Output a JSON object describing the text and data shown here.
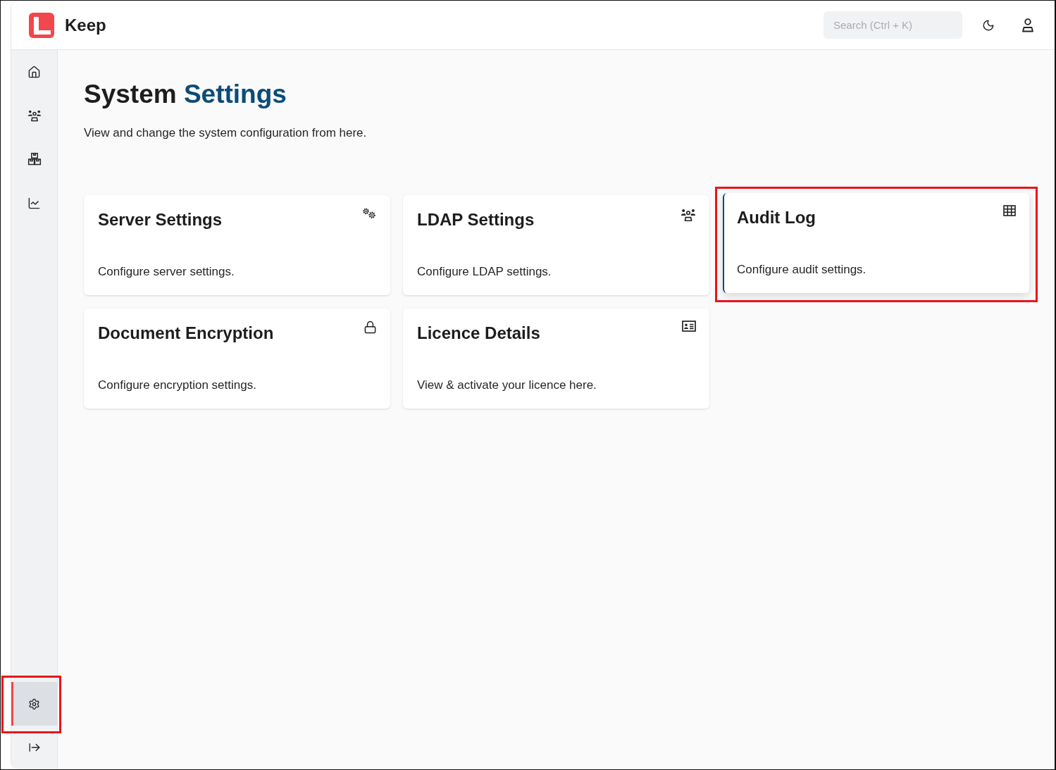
{
  "app": {
    "name": "Keep"
  },
  "header": {
    "search": {
      "placeholder": "Search (Ctrl + K)"
    }
  },
  "sidebar": {
    "top_items": [
      {
        "kind": "home",
        "selected": false,
        "highlighted": false
      },
      {
        "kind": "users",
        "selected": false,
        "highlighted": false
      },
      {
        "kind": "boxes",
        "selected": false,
        "highlighted": false
      },
      {
        "kind": "reports",
        "selected": false,
        "highlighted": false
      }
    ],
    "bottom_items": [
      {
        "kind": "settings",
        "selected": true,
        "highlighted": true
      },
      {
        "kind": "collapse",
        "selected": false,
        "highlighted": false
      }
    ]
  },
  "page": {
    "title": "System",
    "title_accent": "Settings",
    "subtitle": "View and change the system configuration from here."
  },
  "cards": [
    {
      "kind": "server",
      "title": "Server Settings",
      "description": "Configure server settings.",
      "selected": false,
      "highlighted": false
    },
    {
      "kind": "ldap",
      "title": "LDAP Settings",
      "description": "Configure LDAP settings.",
      "selected": false,
      "highlighted": false
    },
    {
      "kind": "audit",
      "title": "Audit Log",
      "description": "Configure audit settings.",
      "selected": true,
      "highlighted": true
    },
    {
      "kind": "encryption",
      "title": "Document Encryption",
      "description": "Configure encryption settings.",
      "selected": false,
      "highlighted": false
    },
    {
      "kind": "licence",
      "title": "Licence Details",
      "description": "View & activate your licence here.",
      "selected": false,
      "highlighted": false
    }
  ]
}
